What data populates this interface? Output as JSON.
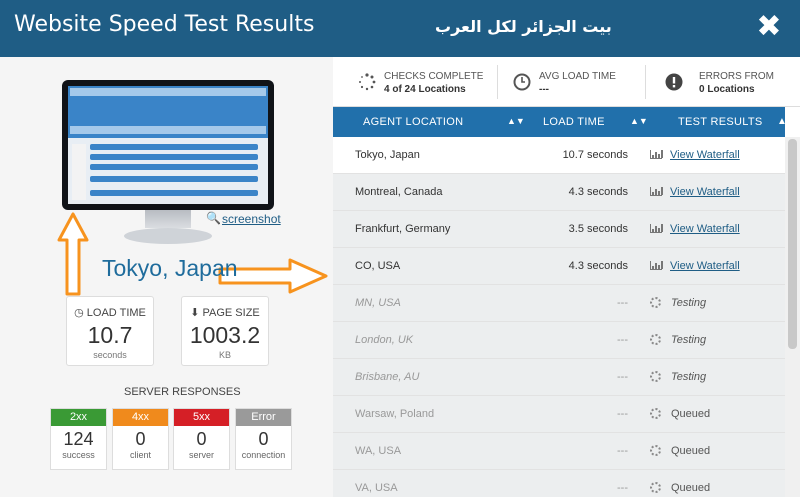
{
  "header": {
    "title": "Website Speed Test Results",
    "site_name": "بيت الجزائر لكل العرب",
    "close_glyph": "✖"
  },
  "left": {
    "screenshot_link": "screenshot",
    "location": "Tokyo, Japan",
    "load_time": {
      "label": "LOAD TIME",
      "value": "10.7",
      "unit": "seconds"
    },
    "page_size": {
      "label": "PAGE SIZE",
      "value": "1003.2",
      "unit": "KB"
    },
    "server_responses_title": "SERVER RESPONSES",
    "responses": [
      {
        "code": "2xx",
        "count": "124",
        "caption": "success",
        "color": "#3a9a35"
      },
      {
        "code": "4xx",
        "count": "0",
        "caption": "client",
        "color": "#f08a1c"
      },
      {
        "code": "5xx",
        "count": "0",
        "caption": "server",
        "color": "#d51f26"
      },
      {
        "code": "Error",
        "count": "0",
        "caption": "connection",
        "color": "#9a9a9a"
      }
    ],
    "arrow_color": "#f7931e"
  },
  "summary": {
    "checks": {
      "label": "CHECKS COMPLETE",
      "value": "4 of 24 Locations"
    },
    "avg": {
      "label": "AVG LOAD TIME",
      "value": "---"
    },
    "errors": {
      "label": "ERRORS FROM",
      "value": "0 Locations"
    }
  },
  "table": {
    "headers": {
      "location": "AGENT LOCATION",
      "load_time": "LOAD TIME",
      "results": "TEST RESULTS"
    },
    "rows": [
      {
        "location": "Tokyo, Japan",
        "time": "10.7 seconds",
        "result": "View Waterfall",
        "state": "done"
      },
      {
        "location": "Montreal, Canada",
        "time": "4.3 seconds",
        "result": "View Waterfall",
        "state": "done"
      },
      {
        "location": "Frankfurt, Germany",
        "time": "3.5 seconds",
        "result": "View Waterfall",
        "state": "done"
      },
      {
        "location": "CO, USA",
        "time": "4.3 seconds",
        "result": "View Waterfall",
        "state": "done"
      },
      {
        "location": "MN, USA",
        "time": "---",
        "result": "Testing",
        "state": "testing"
      },
      {
        "location": "London, UK",
        "time": "---",
        "result": "Testing",
        "state": "testing"
      },
      {
        "location": "Brisbane, AU",
        "time": "---",
        "result": "Testing",
        "state": "testing"
      },
      {
        "location": "Warsaw, Poland",
        "time": "---",
        "result": "Queued",
        "state": "queued"
      },
      {
        "location": "WA, USA",
        "time": "---",
        "result": "Queued",
        "state": "queued"
      },
      {
        "location": "VA, USA",
        "time": "---",
        "result": "Queued",
        "state": "queued"
      }
    ]
  },
  "colors": {
    "header_bg": "#1f5d85",
    "table_header_bg": "#2170ab",
    "accent": "#1f6c9c"
  }
}
